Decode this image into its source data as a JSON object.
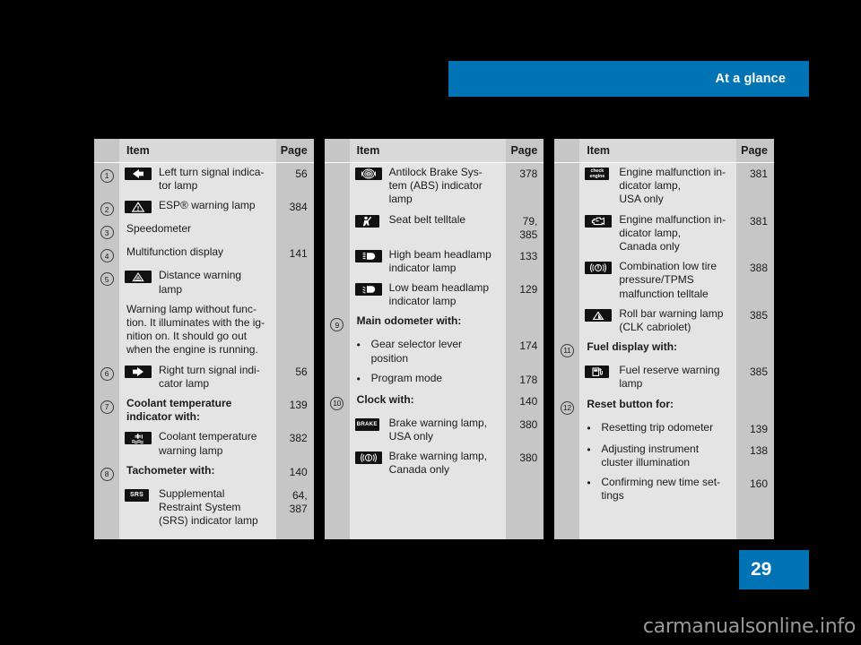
{
  "header": {
    "title": "At a glance",
    "accent_color": "#0073b5"
  },
  "page_marker": {
    "number": "29"
  },
  "watermark": {
    "text": "carmanualsonline.info"
  },
  "columns": [
    {
      "head": {
        "item": "Item",
        "page": "Page"
      },
      "rows": [
        {
          "num": "1",
          "icon": "left-turn-signal-icon",
          "text": "Left turn signal indica-\ntor lamp",
          "page": "56"
        },
        {
          "num": "2",
          "icon": "esp-warning-triangle-icon",
          "text": "ESP® warning lamp",
          "page": "384"
        },
        {
          "num": "3",
          "icon": "",
          "text": "Speedometer",
          "page": ""
        },
        {
          "num": "4",
          "icon": "",
          "text": "Multifunction display",
          "page": "141"
        },
        {
          "num": "5",
          "icon": "distance-warning-icon",
          "text": "Distance warning\nlamp",
          "page": ""
        },
        {
          "num": "",
          "icon": "",
          "text": "Warning lamp without func-\ntion. It illuminates with the ig-\nnition on. It should go out\nwhen the engine is running.",
          "page": ""
        },
        {
          "num": "6",
          "icon": "right-turn-signal-icon",
          "text": "Right turn signal indi-\ncator lamp",
          "page": "56"
        },
        {
          "num": "7",
          "icon": "",
          "bold": true,
          "text": "Coolant temperature\nindicator with:",
          "page": "139"
        },
        {
          "num": "",
          "icon": "coolant-temperature-icon",
          "text": "Coolant temperature\nwarning lamp",
          "page": "382"
        },
        {
          "num": "8",
          "icon": "",
          "bold": true,
          "text": "Tachometer with:",
          "page": "140"
        },
        {
          "num": "",
          "icon": "srs-icon",
          "text": "Supplemental\nRestraint System\n(SRS) indicator lamp",
          "page": "64,\n387"
        }
      ]
    },
    {
      "head": {
        "item": "Item",
        "page": "Page"
      },
      "rows": [
        {
          "num": "",
          "icon": "abs-icon",
          "text": "Antilock Brake Sys-\ntem (ABS) indicator\nlamp",
          "page": "378"
        },
        {
          "num": "",
          "icon": "seat-belt-icon",
          "text": "Seat belt telltale",
          "page": "79,\n385"
        },
        {
          "num": "",
          "icon": "high-beam-icon",
          "text": "High beam headlamp\nindicator lamp",
          "page": "133"
        },
        {
          "num": "",
          "icon": "low-beam-icon",
          "text": "Low beam headlamp\nindicator lamp",
          "page": "129"
        },
        {
          "num": "9",
          "icon": "",
          "bold": true,
          "text": "Main odometer with:",
          "page": ""
        },
        {
          "num": "",
          "bullet": true,
          "text": "Gear selector lever\nposition",
          "page": "174"
        },
        {
          "num": "",
          "bullet": true,
          "text": "Program mode",
          "page": "178"
        },
        {
          "num": "10",
          "icon": "",
          "bold": true,
          "text": "Clock with:",
          "page": "140"
        },
        {
          "num": "",
          "icon": "brake-usa-icon",
          "text": "Brake warning lamp,\nUSA only",
          "page": "380"
        },
        {
          "num": "",
          "icon": "brake-canada-icon",
          "text": "Brake warning lamp,\nCanada only",
          "page": "380"
        }
      ]
    },
    {
      "head": {
        "item": "Item",
        "page": "Page"
      },
      "rows": [
        {
          "num": "",
          "icon": "check-engine-icon",
          "text": "Engine malfunction in-\ndicator lamp,\nUSA only",
          "page": "381"
        },
        {
          "num": "",
          "icon": "engine-outline-icon",
          "text": "Engine malfunction in-\ndicator lamp,\nCanada only",
          "page": "381"
        },
        {
          "num": "",
          "icon": "tire-pressure-icon",
          "text": "Combination low tire\npressure/TPMS\nmalfunction telltale",
          "page": "388"
        },
        {
          "num": "",
          "icon": "roll-bar-icon",
          "text": "Roll bar warning lamp\n(CLK cabriolet)",
          "page": "385"
        },
        {
          "num": "11",
          "icon": "",
          "bold": true,
          "text": "Fuel display with:",
          "page": ""
        },
        {
          "num": "",
          "icon": "fuel-reserve-icon",
          "text": "Fuel reserve warning\nlamp",
          "page": "385"
        },
        {
          "num": "12",
          "icon": "",
          "bold": true,
          "text": "Reset button for:",
          "page": ""
        },
        {
          "num": "",
          "bullet": true,
          "text": "Resetting trip odometer",
          "page": "139"
        },
        {
          "num": "",
          "bullet": true,
          "text": "Adjusting instrument\ncluster illumination",
          "page": "138"
        },
        {
          "num": "",
          "bullet": true,
          "text": "Confirming new time set-\ntings",
          "page": "160"
        }
      ]
    }
  ]
}
